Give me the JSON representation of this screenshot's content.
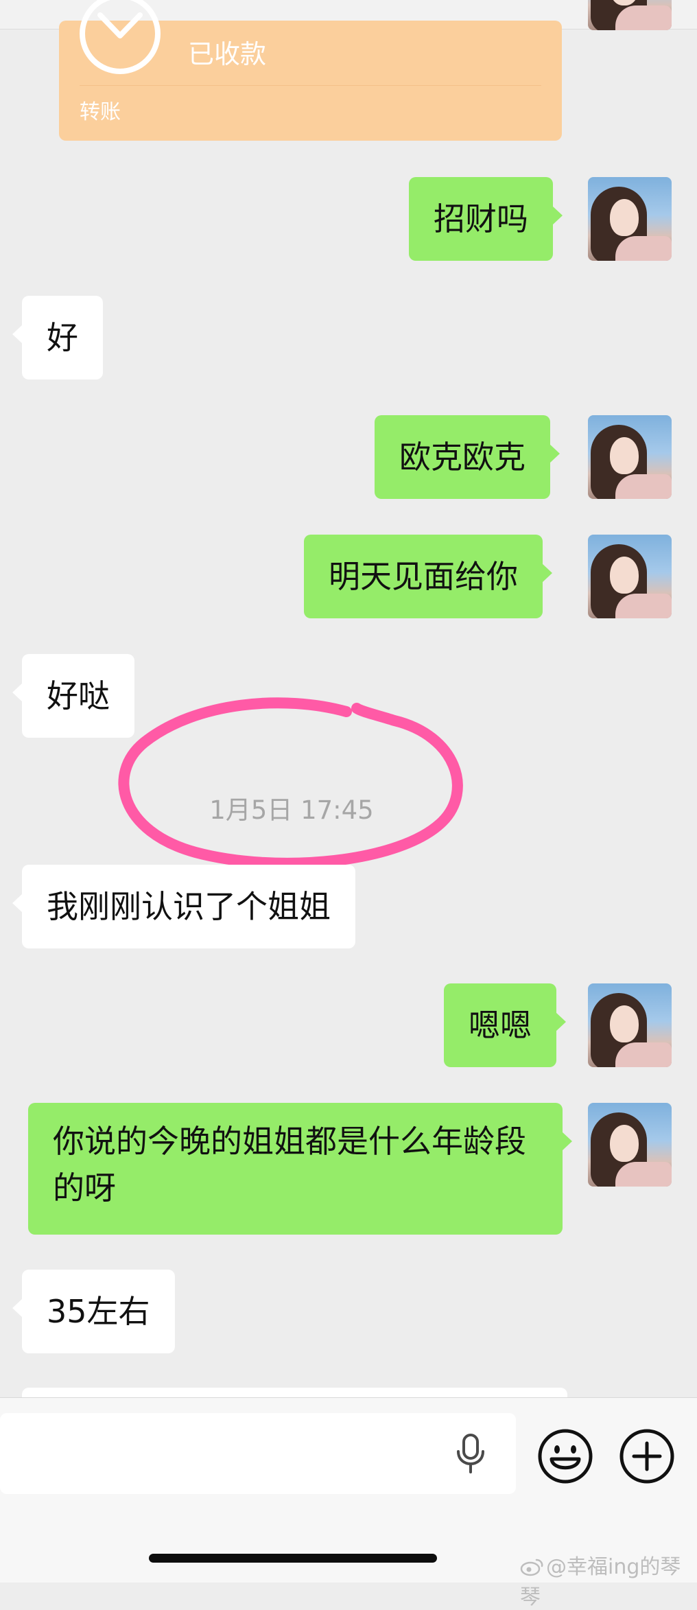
{
  "transfer": {
    "status": "已收款",
    "label": "转账"
  },
  "messages": [
    {
      "text": "招财吗"
    },
    {
      "text": "好"
    },
    {
      "text": "欧克欧克"
    },
    {
      "text": "明天见面给你"
    },
    {
      "text": "好哒"
    },
    {
      "text": "我刚刚认识了个姐姐"
    },
    {
      "text": "嗯嗯"
    },
    {
      "text": "你说的今晚的姐姐都是什么年龄段的呀"
    },
    {
      "text": "35左右"
    }
  ],
  "timestamp": "1月5日 17:45",
  "annotation_color": "#ff5aa6",
  "colors": {
    "self_bubble": "#95ec69",
    "other_bubble": "#ffffff",
    "transfer_card": "#fbcf9c"
  },
  "input_bar": {
    "icons": [
      "microphone-icon",
      "emoji-icon",
      "plus-icon"
    ]
  },
  "watermark": "@幸福ing的琴琴"
}
